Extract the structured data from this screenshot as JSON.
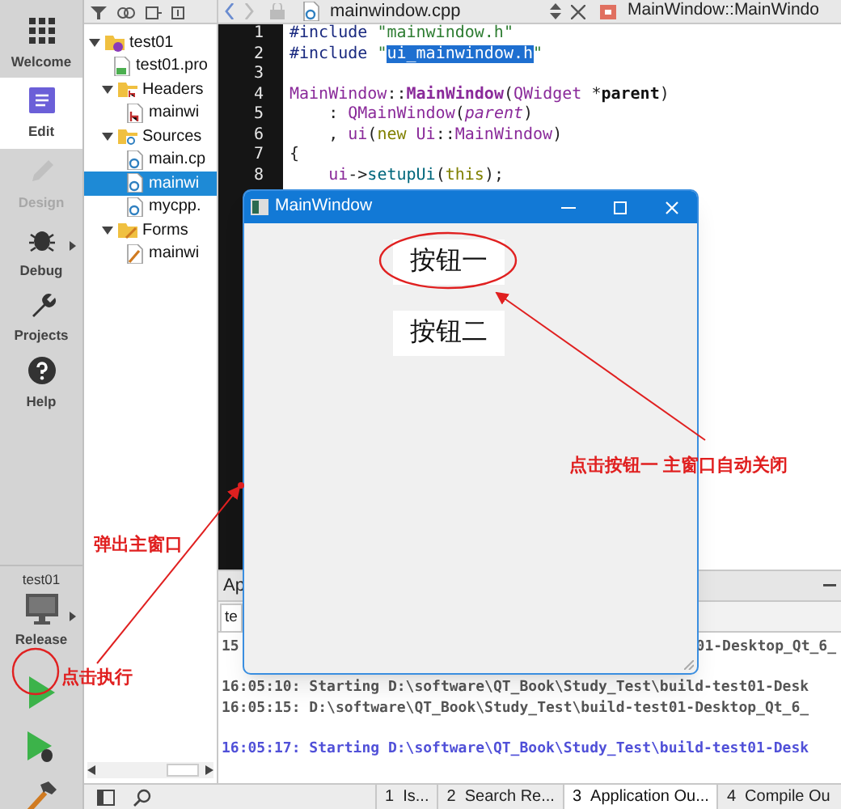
{
  "mode_bar": {
    "items": [
      {
        "label": "Welcome",
        "selected": false,
        "disabled": false
      },
      {
        "label": "Edit",
        "selected": true,
        "disabled": false
      },
      {
        "label": "Design",
        "selected": false,
        "disabled": true
      },
      {
        "label": "Debug",
        "selected": false,
        "disabled": false
      },
      {
        "label": "Projects",
        "selected": false,
        "disabled": false
      },
      {
        "label": "Help",
        "selected": false,
        "disabled": false
      }
    ],
    "kit": {
      "project": "test01",
      "build": "Release"
    }
  },
  "project_tree": {
    "items": [
      {
        "label": "test01",
        "kind": "project",
        "expanded": true,
        "selected": false,
        "children": [
          {
            "label": "test01.pro",
            "kind": "pro",
            "selected": false
          },
          {
            "label": "Headers",
            "kind": "headers",
            "expanded": true,
            "selected": false,
            "children": [
              {
                "label": "mainwi",
                "kind": "header",
                "selected": false
              }
            ]
          },
          {
            "label": "Sources",
            "kind": "sources",
            "expanded": true,
            "selected": false,
            "children": [
              {
                "label": "main.cp",
                "kind": "source",
                "selected": false
              },
              {
                "label": "mainwi",
                "kind": "source",
                "selected": true
              },
              {
                "label": "mycpp.",
                "kind": "source",
                "selected": false
              }
            ]
          },
          {
            "label": "Forms",
            "kind": "forms",
            "expanded": true,
            "selected": false,
            "children": [
              {
                "label": "mainwi",
                "kind": "form",
                "selected": false
              }
            ]
          }
        ]
      }
    ]
  },
  "editor": {
    "file": "mainwindow.cpp",
    "symbol": "MainWindow::MainWindo",
    "lines": [
      {
        "number": "1",
        "tokens": [
          {
            "text": "#include ",
            "kind": "directive"
          },
          {
            "text": "\"mainwindow.h\"",
            "kind": "string"
          }
        ]
      },
      {
        "number": "2",
        "tokens": [
          {
            "text": "#include",
            "kind": "directive"
          },
          {
            "text": " \"",
            "kind": "string"
          },
          {
            "text": "ui_mainwindow.h",
            "kind": "selected"
          },
          {
            "text": "\"",
            "kind": "string"
          }
        ]
      },
      {
        "number": "3"
      },
      {
        "number": "4",
        "tokens": [
          {
            "text": "MainWindow",
            "kind": "type"
          },
          {
            "text": "::",
            "kind": "plain"
          },
          {
            "text": "MainWindow",
            "kind": "decl"
          },
          {
            "text": "(",
            "kind": "plain"
          },
          {
            "text": "QWidget",
            "kind": "type"
          },
          {
            "text": " *",
            "kind": "plain"
          },
          {
            "text": "parent",
            "kind": "bold"
          },
          {
            "text": ")",
            "kind": "plain"
          }
        ]
      },
      {
        "number": "5",
        "tokens": [
          {
            "text": "    : ",
            "kind": "plain"
          },
          {
            "text": "QMainWindow",
            "kind": "type"
          },
          {
            "text": "(",
            "kind": "plain"
          },
          {
            "text": "parent",
            "kind": "param"
          },
          {
            "text": ")",
            "kind": "plain"
          }
        ]
      },
      {
        "number": "6",
        "tokens": [
          {
            "text": "    , ",
            "kind": "plain"
          },
          {
            "text": "ui",
            "kind": "type"
          },
          {
            "text": "(",
            "kind": "plain"
          },
          {
            "text": "new",
            "kind": "keyword"
          },
          {
            "text": " Ui",
            "kind": "type"
          },
          {
            "text": "::",
            "kind": "plain"
          },
          {
            "text": "MainWindow",
            "kind": "type"
          },
          {
            "text": ")",
            "kind": "plain"
          }
        ]
      },
      {
        "number": "7",
        "tokens": [
          {
            "text": "{",
            "kind": "plain"
          }
        ]
      },
      {
        "number": "8",
        "tokens": [
          {
            "text": "    ui",
            "kind": "type"
          },
          {
            "text": "->",
            "kind": "plain"
          },
          {
            "text": "setupUi",
            "kind": "func"
          },
          {
            "text": "(",
            "kind": "plain"
          },
          {
            "text": "this",
            "kind": "keyword"
          },
          {
            "text": ");",
            "kind": "plain"
          }
        ]
      }
    ]
  },
  "output_pane": {
    "title": "Ap",
    "tab": "te",
    "blocks": [
      {
        "kind": "log",
        "lines": [
          {
            "text": "15",
            "tail": "01-Desktop_Qt_6_"
          }
        ]
      },
      {
        "kind": "log",
        "lines": [
          {
            "text": "16:05:10: Starting D:\\software\\QT_Book\\Study_Test\\build-test01-Desk"
          },
          {
            "text": "16:05:15: D:\\software\\QT_Book\\Study_Test\\build-test01-Desktop_Qt_6_"
          }
        ]
      },
      {
        "kind": "launch",
        "lines": [
          {
            "text": "16:05:17: Starting D:\\software\\QT_Book\\Study_Test\\build-test01-Desk"
          }
        ]
      }
    ]
  },
  "status_bar": {
    "tabs": [
      {
        "number": "1",
        "label": "Is...",
        "selected": false
      },
      {
        "number": "2",
        "label": "Search Re...",
        "selected": false
      },
      {
        "number": "3",
        "label": "Application Ou...",
        "selected": true
      },
      {
        "number": "4",
        "label": "Compile Ou",
        "selected": false
      }
    ]
  },
  "app_window": {
    "title": "MainWindow",
    "buttons": [
      "按钮一",
      "按钮二"
    ]
  },
  "annotations": [
    {
      "text": "点击按钮一 主窗口自动关闭"
    },
    {
      "text": "弹出主窗口"
    },
    {
      "text": "点击执行"
    }
  ]
}
